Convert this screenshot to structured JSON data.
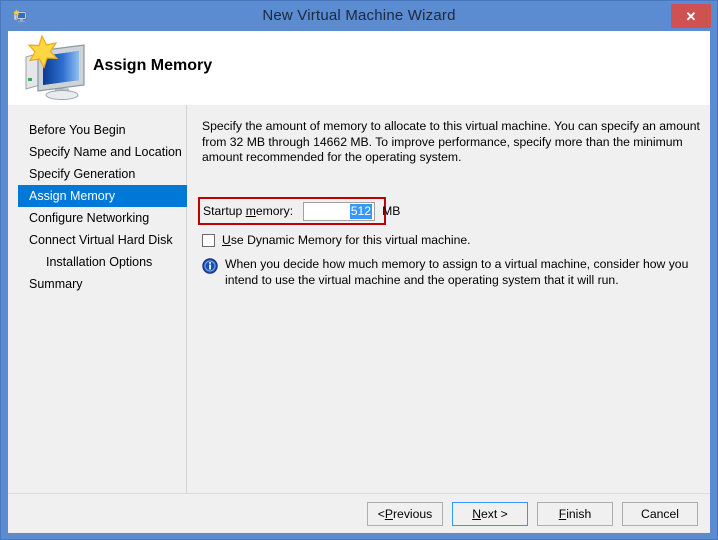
{
  "window": {
    "title": "New Virtual Machine Wizard",
    "icon": "virtual-machine-icon",
    "close_label": "✕",
    "titlebar_color": "#5b8bd0",
    "border_color": "#4878bd"
  },
  "banner": {
    "heading": "Assign Memory",
    "icon": "new-virtual-machine-monitor-icon"
  },
  "sidebar": {
    "items": [
      {
        "label": "Before You Begin",
        "selected": false,
        "indent": false
      },
      {
        "label": "Specify Name and Location",
        "selected": false,
        "indent": false
      },
      {
        "label": "Specify Generation",
        "selected": false,
        "indent": false
      },
      {
        "label": "Assign Memory",
        "selected": true,
        "indent": false
      },
      {
        "label": "Configure Networking",
        "selected": false,
        "indent": false
      },
      {
        "label": "Connect Virtual Hard Disk",
        "selected": false,
        "indent": false
      },
      {
        "label": "Installation Options",
        "selected": false,
        "indent": true
      },
      {
        "label": "Summary",
        "selected": false,
        "indent": false
      }
    ],
    "selection_color": "#0078d7"
  },
  "content": {
    "description": "Specify the amount of memory to allocate to this virtual machine. You can specify an amount from 32 MB through 14662 MB. To improve performance, specify more than the minimum amount recommended for the operating system.",
    "memory": {
      "label_prefix": "Startup ",
      "label_accel": "m",
      "label_suffix": "emory:",
      "value": "512",
      "unit": "MB",
      "selected": true,
      "highlight_color": "#c00000",
      "selection_color": "#3399ff"
    },
    "dynamic_memory": {
      "checked": false,
      "label_prefix": "",
      "label_accel": "U",
      "label_suffix": "se Dynamic Memory for this virtual machine."
    },
    "note": {
      "icon": "info-icon",
      "text": "When you decide how much memory to assign to a virtual machine, consider how you intend to use the virtual machine and the operating system that it will run."
    }
  },
  "footer": {
    "buttons": [
      {
        "name": "previous",
        "prefix": "< ",
        "accel": "P",
        "suffix": "revious",
        "default": false
      },
      {
        "name": "next",
        "prefix": "",
        "accel": "N",
        "suffix": "ext >",
        "default": true
      },
      {
        "name": "finish",
        "prefix": "",
        "accel": "F",
        "suffix": "inish",
        "default": false
      },
      {
        "name": "cancel",
        "prefix": "",
        "accel": "",
        "suffix": "Cancel",
        "default": false
      }
    ]
  }
}
